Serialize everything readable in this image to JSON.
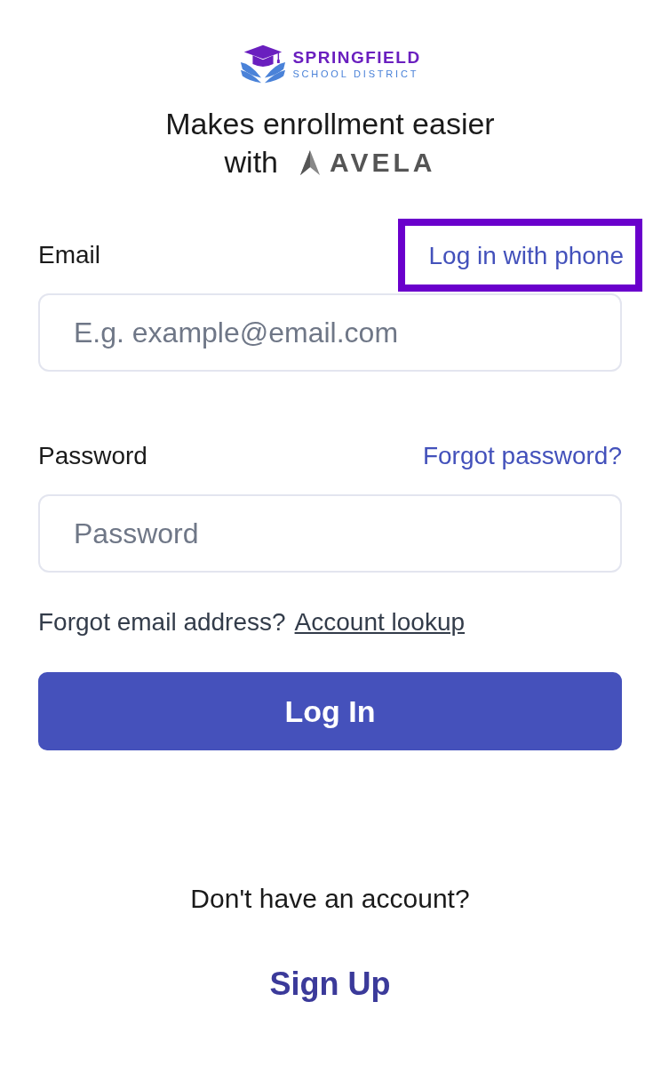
{
  "logo": {
    "name": "SPRINGFIELD",
    "subtitle": "SCHOOL DISTRICT"
  },
  "tagline": {
    "line_1": "Makes enrollment easier",
    "line_2": "with",
    "brand": "AVELA"
  },
  "email": {
    "label": "Email",
    "link": "Log in with phone",
    "link_highlighted": true,
    "placeholder": "E.g. example@email.com"
  },
  "password": {
    "label": "Password",
    "link": "Forgot password?",
    "placeholder": "Password"
  },
  "account_lookup": {
    "text": "Forgot email address?",
    "link": "Account lookup"
  },
  "login_button": "Log In",
  "signup": {
    "prompt": "Don't have an account?",
    "link": "Sign Up"
  }
}
